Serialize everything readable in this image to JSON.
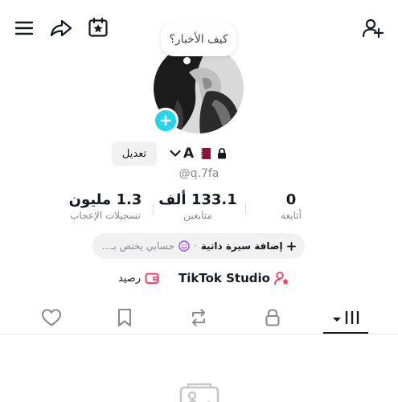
{
  "bubble": {
    "text": "كيف الأخبار؟"
  },
  "profile": {
    "edit_label": "تعديل",
    "display_name": "A",
    "handle": "@q.7fa"
  },
  "stats": {
    "likes": {
      "value": "1.3 مليون",
      "label": "تسجيلات الإعجاب"
    },
    "followers": {
      "value": "133.1 ألف",
      "label": "متابعين"
    },
    "following": {
      "value": "0",
      "label": "أتابعه"
    }
  },
  "bio": {
    "add_label": "إضافة سيرة ذاتية",
    "separator": "·",
    "hint": "حسابي يختص بـ..."
  },
  "studio": {
    "studio_label": "TikTok Studio",
    "balance_label": "رصيد"
  },
  "tabs": [
    "videos-grid",
    "private",
    "reposts",
    "favorites",
    "liked"
  ],
  "colors": {
    "accent": "#20d5ec",
    "brand_red": "#fe2c55",
    "text": "#161823",
    "muted": "#8a8b91"
  }
}
